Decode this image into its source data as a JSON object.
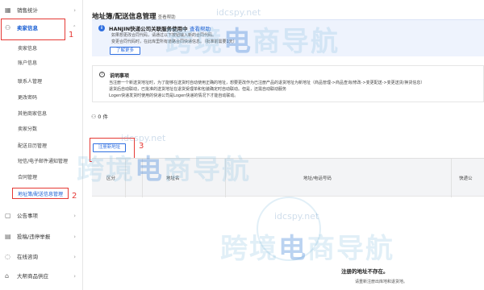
{
  "sidebar": {
    "top_item": "销售统计",
    "section": {
      "label": "卖家信息",
      "icon": "user-icon"
    },
    "sub_items": [
      {
        "label": "卖家信息",
        "active": false
      },
      {
        "label": "账户信息",
        "active": false
      },
      {
        "label": "联系人管理",
        "active": false
      },
      {
        "label": "更改密码",
        "active": false
      },
      {
        "label": "其他商家信息",
        "active": false
      },
      {
        "label": "卖家分数",
        "active": false
      },
      {
        "label": "配送日历管理",
        "active": false
      },
      {
        "label": "短信/电子邮件通知管理",
        "active": false
      },
      {
        "label": "合同管理",
        "active": false
      },
      {
        "label": "地址簿/配送信息管理",
        "active": true
      }
    ],
    "bottom_items": [
      {
        "label": "公告事项",
        "icon": "calendar-icon"
      },
      {
        "label": "投稿/违停举报",
        "icon": "report-icon"
      },
      {
        "label": "在线咨询",
        "icon": "chat-icon"
      },
      {
        "label": "大帮商品供应",
        "icon": "store-icon"
      }
    ]
  },
  "annotations": [
    "1",
    "2",
    "3"
  ],
  "main": {
    "title": "地址簿/配送信息管理",
    "title_help": "查看帮助",
    "info": {
      "title": "HANJIN快递公司关联服务使用中",
      "title_link": "查看帮助",
      "lines": [
        "如果想更改合同代码，请通过以下按钮输入新的合同代码。",
        "变更合同代码时，在此库里所有道路合同快递信息。（批准前需要1天）"
      ],
      "button": "了解更多"
    },
    "notice": {
      "title": "说明事项",
      "lines": [
        "当注册一个新送货地址时，为了能够在送货时自动使用正确的地址，想要更改作为已注册产品的退货地址为新地址（商品管理->商品查询/修改->变更配送->变更送货/换货信息）",
        "退货后自动联动，已批准的送货地址在退货受理单和包装确定时自动联动。但是，还需自动联动服务",
        "Logen快递发货时使用的快递公司是Logen快递的情况下才能自动联动。"
      ]
    },
    "count_label": "0 件",
    "register_button": "注册新地址",
    "table": {
      "columns": [
        "区分",
        "地址名",
        "地址/电话号码",
        "快递公"
      ]
    },
    "empty": {
      "title": "注册的地址不存在。",
      "subtitle": "请重新注册出库地和退货地。"
    }
  },
  "watermark": {
    "text_a": "跨境",
    "text_hl": "电",
    "text_b": "商导航",
    "url": "idcspy.net"
  }
}
